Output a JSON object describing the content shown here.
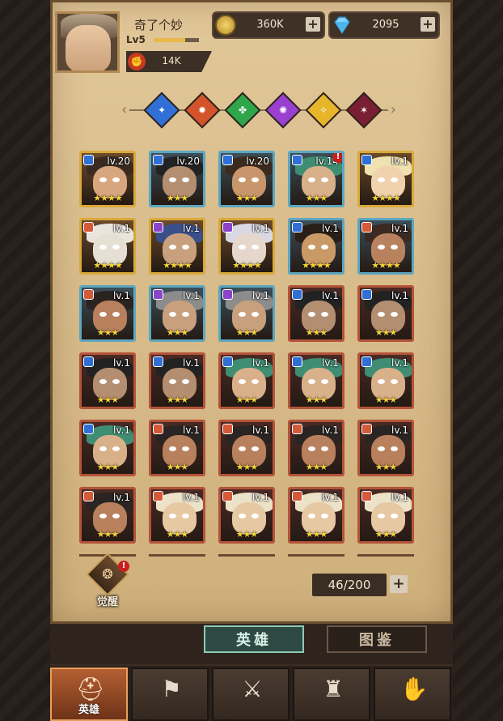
{
  "player": {
    "name": "奇了个妙",
    "level": "Lv5",
    "xp_fraction": 0.7,
    "power": "14K"
  },
  "resources": {
    "gold": "360K",
    "gems": "2095"
  },
  "factions": [
    {
      "icon": "blue-faction-icon",
      "color": "#2f6fd6"
    },
    {
      "icon": "red-faction-icon",
      "color": "#d4532a"
    },
    {
      "icon": "green-faction-icon",
      "color": "#2fa64a"
    },
    {
      "icon": "purple-faction-icon",
      "color": "#9a3fd0"
    },
    {
      "icon": "light-faction-icon",
      "color": "#e6b52a"
    },
    {
      "icon": "dark-faction-icon",
      "color": "#7a1f33"
    }
  ],
  "heroes": [
    {
      "level": "lv.20",
      "stars": "★★★★",
      "faction": "blue",
      "frame": "gold",
      "alert": false,
      "hair": "#3a2a22",
      "skin": "#d8a67e"
    },
    {
      "level": "lv.20",
      "stars": "★★★",
      "faction": "blue",
      "frame": "blue",
      "alert": false,
      "hair": "#222",
      "skin": "#b48e70"
    },
    {
      "level": "lv.20",
      "stars": "★★★",
      "faction": "blue",
      "frame": "blue",
      "alert": false,
      "hair": "#3b2a1e",
      "skin": "#c9966c"
    },
    {
      "level": "lv.14",
      "stars": "★★★",
      "faction": "blue",
      "frame": "blue",
      "alert": true,
      "hair": "#3f8d72",
      "skin": "#d8b08a"
    },
    {
      "level": "lv.1",
      "stars": "★★★★",
      "faction": "blue",
      "frame": "gold",
      "alert": false,
      "hair": "#efe2b0",
      "skin": "#f0d2ad"
    },
    {
      "level": "lv.1",
      "stars": "★★★★",
      "faction": "red",
      "frame": "gold",
      "alert": false,
      "hair": "#e9e5dc",
      "skin": "#e6e0d4"
    },
    {
      "level": "lv.1",
      "stars": "★★★★",
      "faction": "purple",
      "frame": "gold",
      "alert": false,
      "hair": "#3a4f8a",
      "skin": "#c9a07d"
    },
    {
      "level": "lv.1",
      "stars": "★★★★",
      "faction": "purple",
      "frame": "gold",
      "alert": false,
      "hair": "#d9d9e4",
      "skin": "#e6d7cc"
    },
    {
      "level": "lv.1",
      "stars": "★★★★",
      "faction": "blue",
      "frame": "blue",
      "alert": false,
      "hair": "#2a1e18",
      "skin": "#c99a66"
    },
    {
      "level": "lv.1",
      "stars": "★★★★",
      "faction": "red",
      "frame": "blue",
      "alert": false,
      "hair": "#3a2a22",
      "skin": "#b8825e"
    },
    {
      "level": "lv.1",
      "stars": "★★★",
      "faction": "red",
      "frame": "blue",
      "alert": false,
      "hair": "#2b2320",
      "skin": "#b8805c"
    },
    {
      "level": "lv.1",
      "stars": "★★★",
      "faction": "purple",
      "frame": "blue",
      "alert": false,
      "hair": "#8c8c8c",
      "skin": "#c9a07d"
    },
    {
      "level": "lv.1",
      "stars": "★★★",
      "faction": "purple",
      "frame": "blue",
      "alert": false,
      "hair": "#8c8c8c",
      "skin": "#c9a07d"
    },
    {
      "level": "lv.1",
      "stars": "★★★",
      "faction": "blue",
      "frame": "red",
      "alert": false,
      "hair": "#222",
      "skin": "#b48e70"
    },
    {
      "level": "lv.1",
      "stars": "★★★",
      "faction": "blue",
      "frame": "red",
      "alert": false,
      "hair": "#222",
      "skin": "#b48e70"
    },
    {
      "level": "lv.1",
      "stars": "★★★",
      "faction": "blue",
      "frame": "red",
      "alert": false,
      "hair": "#222",
      "skin": "#b48e70"
    },
    {
      "level": "lv.1",
      "stars": "★★★",
      "faction": "blue",
      "frame": "red",
      "alert": false,
      "hair": "#222",
      "skin": "#b48e70"
    },
    {
      "level": "lv.1",
      "stars": "★★★",
      "faction": "blue",
      "frame": "red",
      "alert": false,
      "hair": "#3f8d72",
      "skin": "#d8b08a"
    },
    {
      "level": "lv.1",
      "stars": "★★★",
      "faction": "blue",
      "frame": "red",
      "alert": false,
      "hair": "#3f8d72",
      "skin": "#d8b08a"
    },
    {
      "level": "lv.1",
      "stars": "★★★",
      "faction": "blue",
      "frame": "red",
      "alert": false,
      "hair": "#3f8d72",
      "skin": "#d8b08a"
    },
    {
      "level": "lv.1",
      "stars": "★★★",
      "faction": "blue",
      "frame": "red",
      "alert": false,
      "hair": "#3f8d72",
      "skin": "#d8b08a"
    },
    {
      "level": "lv.1",
      "stars": "★★★",
      "faction": "red",
      "frame": "red",
      "alert": false,
      "hair": "#2a2422",
      "skin": "#b8805c"
    },
    {
      "level": "lv.1",
      "stars": "★★★",
      "faction": "red",
      "frame": "red",
      "alert": false,
      "hair": "#2a2422",
      "skin": "#b8805c"
    },
    {
      "level": "lv.1",
      "stars": "★★★",
      "faction": "red",
      "frame": "red",
      "alert": false,
      "hair": "#2a2422",
      "skin": "#b8805c"
    },
    {
      "level": "lv.1",
      "stars": "★★★",
      "faction": "red",
      "frame": "red",
      "alert": false,
      "hair": "#2a2422",
      "skin": "#b8805c"
    },
    {
      "level": "lv.1",
      "stars": "★★★",
      "faction": "red",
      "frame": "red",
      "alert": false,
      "hair": "#2a2422",
      "skin": "#b8805c"
    },
    {
      "level": "lv.1",
      "stars": "★★★",
      "faction": "red",
      "frame": "red",
      "alert": false,
      "hair": "#ece2c8",
      "skin": "#e6c9a3"
    },
    {
      "level": "lv.1",
      "stars": "★★★",
      "faction": "red",
      "frame": "red",
      "alert": false,
      "hair": "#ece2c8",
      "skin": "#e6c9a3"
    },
    {
      "level": "lv.1",
      "stars": "★★★",
      "faction": "red",
      "frame": "red",
      "alert": false,
      "hair": "#ece2c8",
      "skin": "#e6c9a3"
    },
    {
      "level": "lv.1",
      "stars": "★★★",
      "faction": "red",
      "frame": "red",
      "alert": false,
      "hair": "#ece2c8",
      "skin": "#e6c9a3"
    }
  ],
  "awaken": {
    "label": "觉醒",
    "icon": "awaken-icon"
  },
  "capacity": "46/200",
  "tabs": {
    "heroes": "英雄",
    "codex": "图鉴"
  },
  "nav": [
    {
      "label": "英雄",
      "icon": "hero-helmet-icon",
      "glyph": "⛑",
      "active": true
    },
    {
      "label": "",
      "icon": "battle-flag-icon",
      "glyph": "⚑",
      "active": false
    },
    {
      "label": "",
      "icon": "crossed-swords-icon",
      "glyph": "⚔",
      "active": false
    },
    {
      "label": "",
      "icon": "castle-icon",
      "glyph": "♜",
      "active": false
    },
    {
      "label": "",
      "icon": "handshake-icon",
      "glyph": "✋",
      "active": false
    }
  ],
  "colors": {
    "frame_gold": "#d9a93a",
    "frame_blue": "#5ea6bf",
    "frame_red": "#b4533a",
    "faction_blue": "#2f6fd6",
    "faction_red": "#d45a3a",
    "faction_purple": "#8a45c9"
  }
}
